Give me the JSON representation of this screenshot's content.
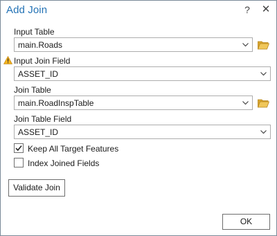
{
  "dialog": {
    "title": "Add Join",
    "help_label": "?",
    "close_label": "✕"
  },
  "fields": {
    "input_table": {
      "label": "Input Table",
      "value": "main.Roads"
    },
    "input_join_field": {
      "label": "Input Join Field",
      "value": "ASSET_ID"
    },
    "join_table": {
      "label": "Join Table",
      "value": "main.RoadInspTable"
    },
    "join_table_field": {
      "label": "Join Table Field",
      "value": "ASSET_ID"
    }
  },
  "options": {
    "keep_all": {
      "label": "Keep All Target Features",
      "checked": true
    },
    "index_joined": {
      "label": "Index Joined Fields",
      "checked": false
    }
  },
  "buttons": {
    "validate": "Validate Join",
    "ok": "OK"
  },
  "colors": {
    "title": "#2372b5",
    "warning": "#e8a318",
    "folder": "#e6b93c"
  }
}
